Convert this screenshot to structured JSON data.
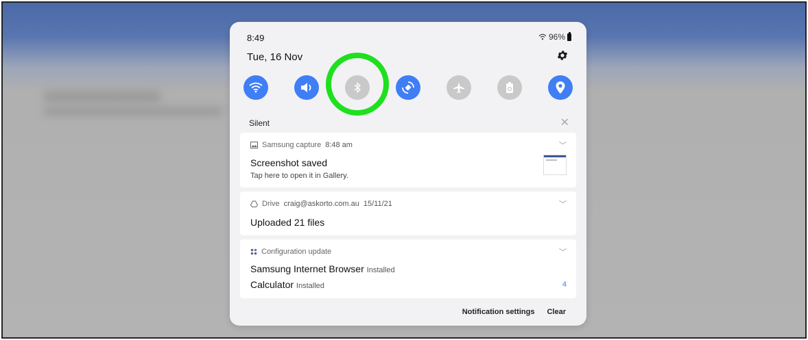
{
  "status": {
    "time": "8:49",
    "battery": "96%"
  },
  "header": {
    "date": "Tue, 16 Nov"
  },
  "quick_settings": [
    {
      "name": "wifi",
      "state": "on"
    },
    {
      "name": "sound",
      "state": "on"
    },
    {
      "name": "bluetooth",
      "state": "off"
    },
    {
      "name": "auto-rotate",
      "state": "on"
    },
    {
      "name": "airplane-mode",
      "state": "off"
    },
    {
      "name": "power-saving",
      "state": "off"
    },
    {
      "name": "location",
      "state": "on"
    }
  ],
  "colors": {
    "accent": "#3f7ef5",
    "off": "#c9c9c9",
    "highlight": "#1ee01e"
  },
  "section": {
    "label": "Silent"
  },
  "notifications": [
    {
      "app": "Samsung capture",
      "time": "8:48 am",
      "title": "Screenshot saved",
      "subtitle": "Tap here to open it in Gallery."
    },
    {
      "app": "Drive",
      "account": "craig@askorto.com.au",
      "time": "15/11/21",
      "title": "Uploaded 21 files"
    },
    {
      "app": "Configuration update",
      "items": [
        {
          "name": "Samsung Internet Browser",
          "status": "Installed"
        },
        {
          "name": "Calculator",
          "status": "Installed"
        }
      ],
      "count": "4"
    }
  ],
  "footer": {
    "settings": "Notification settings",
    "clear": "Clear"
  }
}
